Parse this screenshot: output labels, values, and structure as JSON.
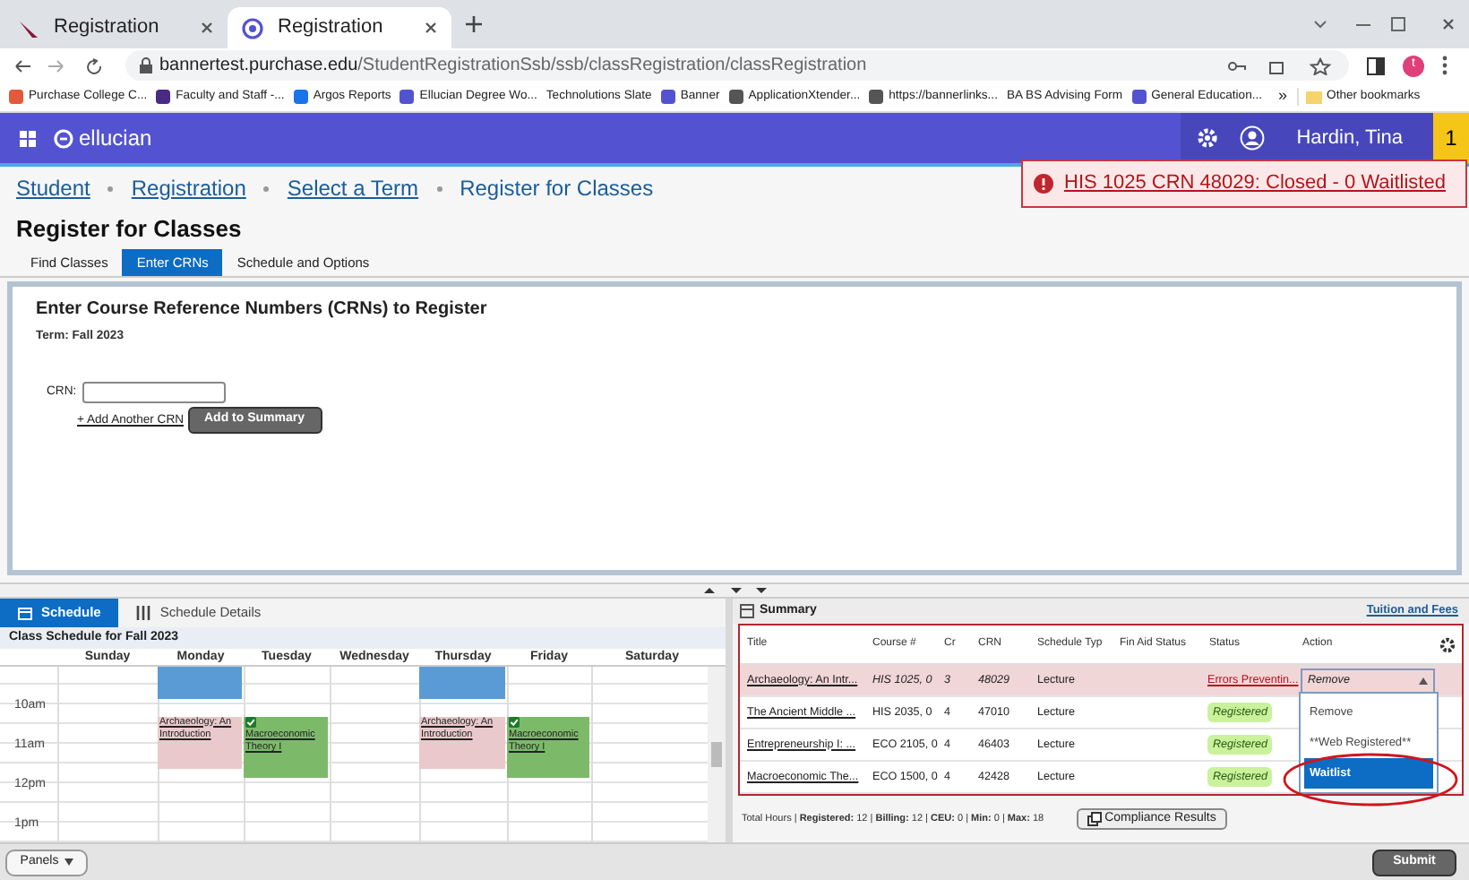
{
  "browser": {
    "tabs": [
      {
        "title": "Registration",
        "selected": false
      },
      {
        "title": "Registration",
        "selected": true
      }
    ],
    "url_host": "bannertest.purchase.edu",
    "url_path": "/StudentRegistrationSsb/ssb/classRegistration/classRegistration",
    "bookmarks": [
      "Purchase College C...",
      "Faculty and Staff -...",
      "Argos Reports",
      "Ellucian Degree Wo...",
      "Technolutions Slate",
      "Banner",
      "ApplicationXtender...",
      "https://bannerlinks...",
      "BA BS Advising Form",
      "General Education..."
    ],
    "more": "»",
    "other_bookmarks": "Other bookmarks",
    "profile_initial": "t"
  },
  "header": {
    "logo": "ellucian",
    "user": "Hardin, Tina",
    "notification_count": "1"
  },
  "breadcrumb": [
    {
      "label": "Student",
      "link": true
    },
    {
      "label": "Registration",
      "link": true
    },
    {
      "label": "Select a Term",
      "link": true
    },
    {
      "label": "Register for Classes",
      "link": false
    }
  ],
  "alert": "HIS 1025 CRN 48029: Closed - 0 Waitlisted",
  "page_title": "Register for Classes",
  "tabs": [
    {
      "label": "Find Classes",
      "selected": false
    },
    {
      "label": "Enter CRNs",
      "selected": true
    },
    {
      "label": "Schedule and Options",
      "selected": false
    }
  ],
  "crn_panel": {
    "heading": "Enter Course Reference Numbers (CRNs) to Register",
    "term": "Term: Fall 2023",
    "crn_label": "CRN:",
    "add_link": "+ Add Another CRN",
    "add_button": "Add to Summary"
  },
  "schedule": {
    "tabs": [
      {
        "label": "Schedule",
        "selected": true
      },
      {
        "label": "Schedule Details",
        "selected": false
      }
    ],
    "title": "Class Schedule for Fall 2023",
    "times": [
      "10am",
      "11am",
      "12pm",
      "1pm"
    ],
    "days": [
      {
        "label": "Sunday"
      },
      {
        "label": "Monday",
        "events": [
          {
            "kind": "block",
            "color": "#5b9bd5"
          },
          {
            "kind": "pending",
            "title": "Archaeology: An Introduction",
            "color": "#e9c9cb"
          }
        ]
      },
      {
        "label": "Tuesday",
        "events": [
          {
            "kind": "registered",
            "title": "Macroeconomic Theory I",
            "color": "#7cba6a"
          }
        ]
      },
      {
        "label": "Wednesday"
      },
      {
        "label": "Thursday",
        "events": [
          {
            "kind": "block",
            "color": "#5b9bd5"
          },
          {
            "kind": "pending",
            "title": "Archaeology: An Introduction",
            "color": "#e9c9cb"
          }
        ]
      },
      {
        "label": "Friday",
        "events": [
          {
            "kind": "registered",
            "title": "Macroeconomic Theory I",
            "color": "#7cba6a"
          }
        ]
      },
      {
        "label": "Saturday"
      }
    ]
  },
  "summary": {
    "title": "Summary",
    "fees_link": "Tuition and Fees",
    "columns": [
      "Title",
      "Course #",
      "Cr",
      "CRN",
      "Schedule Typ",
      "Fin Aid Status",
      "Status",
      "Action"
    ],
    "rows": [
      {
        "title": "Archaeology: An Intr...",
        "course": "HIS 1025, 0",
        "cr": "3",
        "crn": "48029",
        "type": "Lecture",
        "status": "Errors Preventin...",
        "kind": "error",
        "action": "Remove",
        "pending": true
      },
      {
        "title": "The Ancient Middle ...",
        "course": "HIS 2035, 0",
        "cr": "4",
        "crn": "47010",
        "type": "Lecture",
        "status": "Registered",
        "kind": "registered",
        "pending": false
      },
      {
        "title": "Entrepreneurship I: ...",
        "course": "ECO 2105, 0",
        "cr": "4",
        "crn": "46403",
        "type": "Lecture",
        "status": "Registered",
        "kind": "registered",
        "pending": false
      },
      {
        "title": "Macroeconomic The...",
        "course": "ECO 1500, 0",
        "cr": "4",
        "crn": "42428",
        "type": "Lecture",
        "status": "Registered",
        "kind": "registered",
        "pending": false
      }
    ],
    "dropdown_options": [
      {
        "label": "Remove",
        "selected": false
      },
      {
        "label": "**Web Registered**",
        "selected": false
      },
      {
        "label": "Waitlist",
        "selected": true
      }
    ],
    "totals": "Total Hours | **Registered:** 12 | **Billing:** 12 | **CEU:** 0 | **Min:** 0 | **Max:** 18",
    "compliance_button": "Compliance Results"
  },
  "footer": {
    "panels_button": "Panels",
    "submit_button": "Submit"
  }
}
